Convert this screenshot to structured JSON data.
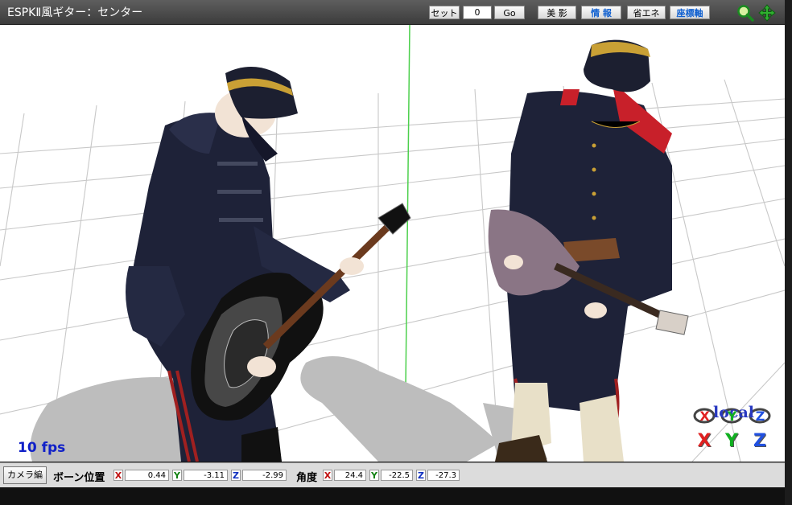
{
  "window": {
    "title": "ESPKⅡ風ギター：センター"
  },
  "toolbar": {
    "set_label": "セット",
    "frame_value": "0",
    "go_label": "Go",
    "beauty_label": "美 影",
    "info_label": "情 報",
    "save_energy_label": "省エネ",
    "axis_label": "座標軸",
    "zoom_icon": "zoom-icon",
    "move_icon": "move-arrows-icon"
  },
  "viewport": {
    "fps": "10 fps",
    "local_label": "local",
    "rotate_x": "X",
    "rotate_y": "Y",
    "rotate_z": "Z",
    "move_x": "X",
    "move_y": "Y",
    "move_z": "Z"
  },
  "bottom": {
    "camera_button": "カメラ編",
    "bone_position_label": "ボーン位置",
    "pos_x_axis": "X",
    "pos_x": "0.44",
    "pos_y_axis": "Y",
    "pos_y": "-3.11",
    "pos_z_axis": "Z",
    "pos_z": "-2.99",
    "angle_label": "角度",
    "ang_x_axis": "X",
    "ang_x": "24.4",
    "ang_y_axis": "Y",
    "ang_y": "-22.5",
    "ang_z_axis": "Z",
    "ang_z": "-27.3"
  },
  "colors": {
    "accent_blue": "#1060d0",
    "axis_x": "#c01010",
    "axis_y": "#108010",
    "axis_z": "#1030c0",
    "grid": "#c8c8c8",
    "uniform": "#1e2238"
  }
}
